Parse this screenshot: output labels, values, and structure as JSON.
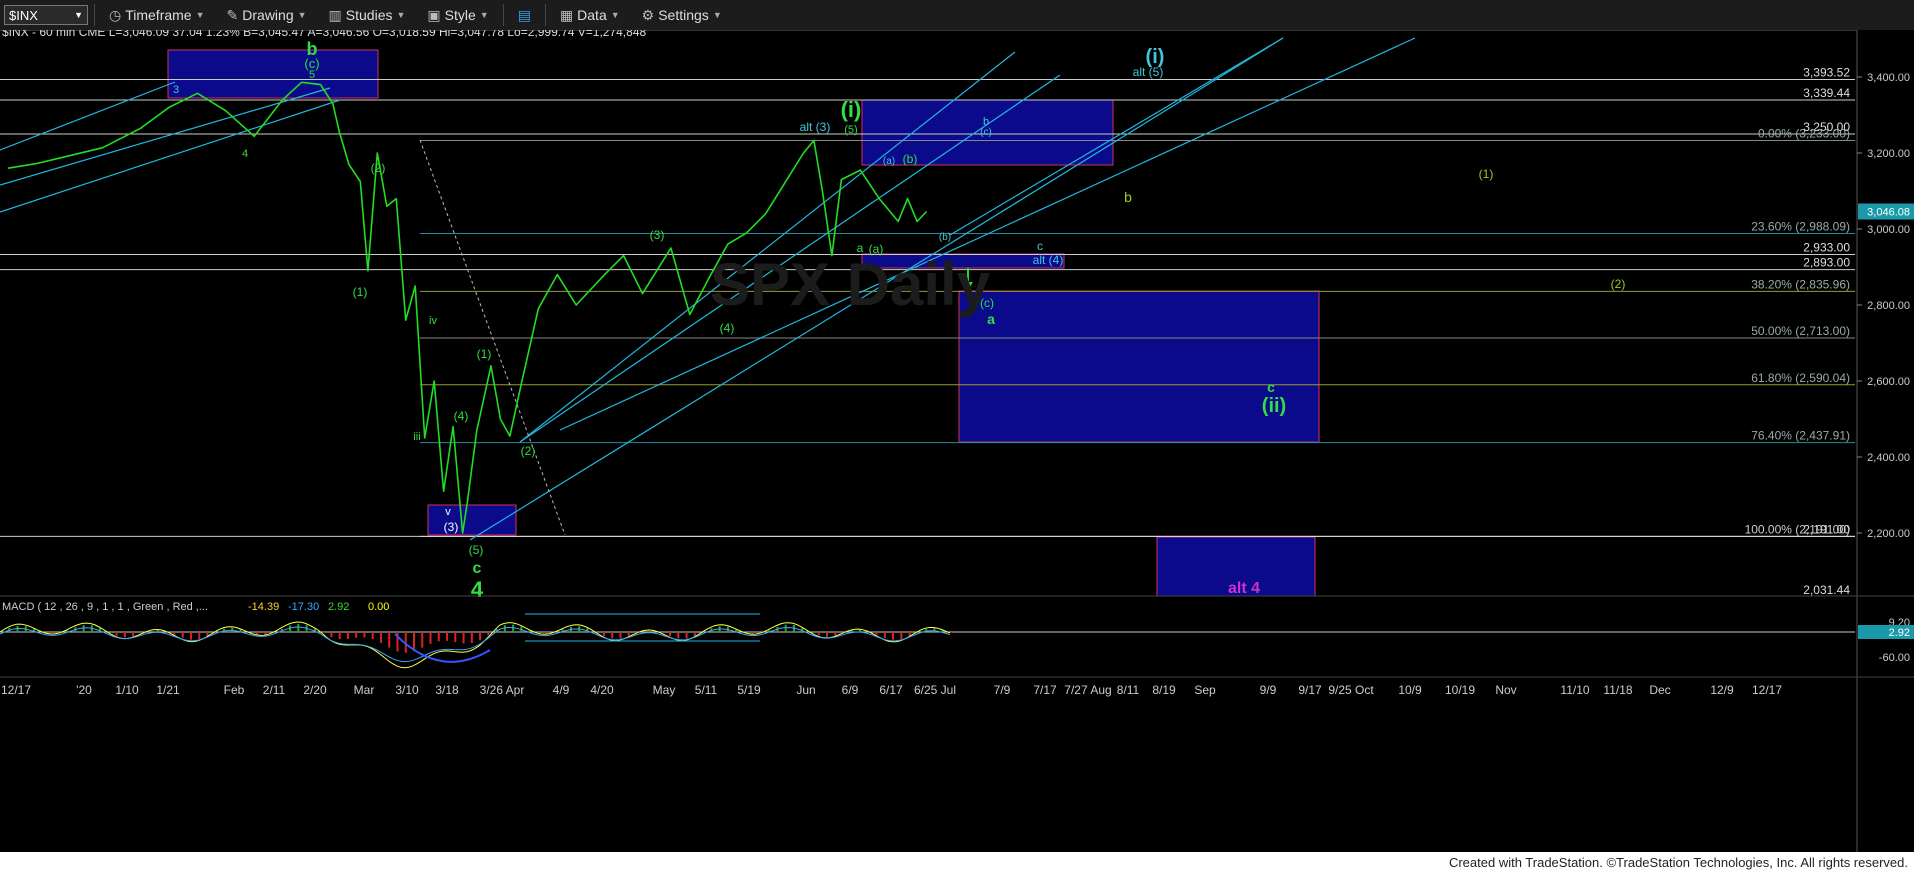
{
  "toolbar": {
    "symbol": "$INX",
    "timeframe": "Timeframe",
    "drawing": "Drawing",
    "studies": "Studies",
    "style": "Style",
    "data": "Data",
    "settings": "Settings"
  },
  "header_line": "$INX - 60 min  CME  L=3,046.09  37.04  1.23%  B=3,045.47  A=3,046.56  O=3,018.59  Hi=3,047.78  Lo=2,999.74  V=1,274,848",
  "footer": "Created with TradeStation. ©TradeStation Technologies, Inc. All rights reserved.",
  "colors": {
    "price": "#22dd22",
    "channel": "#20b8e0",
    "box_fill": "#0a0a8a",
    "box_border": "#d03060",
    "label_green": "#33dd44",
    "label_cyan": "#40c8d8",
    "alt4": "#cc33cc",
    "last_price_bg": "#1a9aa8"
  },
  "chart_data": {
    "type": "line",
    "title": "$INX - 60 min",
    "ylim": [
      2031.44,
      3480
    ],
    "yticks": [
      "3,400.00",
      "3,200.00",
      "3,000.00",
      "2,800.00",
      "2,600.00",
      "2,400.00",
      "2,200.00"
    ],
    "xticks": [
      "12/17",
      "'20",
      "1/10",
      "1/21",
      "Feb",
      "2/11",
      "2/20",
      "Mar",
      "3/10",
      "3/18",
      "3/26 Apr",
      "4/9",
      "4/20",
      "May",
      "5/11",
      "5/19",
      "Jun",
      "6/9",
      "6/17",
      "6/25 Jul",
      "7/9",
      "7/17",
      "7/27 Aug",
      "8/11",
      "8/19",
      "Sep",
      "9/9",
      "9/17",
      "9/25 Oct",
      "10/9",
      "10/19",
      "Nov",
      "11/10",
      "11/18",
      "Dec",
      "12/9",
      "12/17"
    ],
    "last_price": "3,046.08",
    "series": [
      {
        "values": [
          [
            0,
            3160
          ],
          [
            0.03,
            3172
          ],
          [
            0.06,
            3190
          ],
          [
            0.1,
            3214
          ],
          [
            0.14,
            3265
          ],
          [
            0.17,
            3320
          ],
          [
            0.2,
            3357
          ],
          [
            0.23,
            3311
          ],
          [
            0.26,
            3244
          ],
          [
            0.29,
            3340
          ],
          [
            0.31,
            3386
          ],
          [
            0.33,
            3380
          ],
          [
            0.343,
            3330
          ],
          [
            0.35,
            3255
          ],
          [
            0.36,
            3170
          ],
          [
            0.372,
            3125
          ],
          [
            0.38,
            2890
          ],
          [
            0.39,
            3200
          ],
          [
            0.4,
            3060
          ],
          [
            0.41,
            3080
          ],
          [
            0.42,
            2760
          ],
          [
            0.43,
            2850
          ],
          [
            0.44,
            2450
          ],
          [
            0.45,
            2600
          ],
          [
            0.46,
            2310
          ],
          [
            0.47,
            2480
          ],
          [
            0.48,
            2200
          ],
          [
            0.485,
            2280
          ],
          [
            0.495,
            2470
          ],
          [
            0.51,
            2640
          ],
          [
            0.52,
            2500
          ],
          [
            0.53,
            2455
          ],
          [
            0.54,
            2570
          ],
          [
            0.56,
            2790
          ],
          [
            0.58,
            2880
          ],
          [
            0.6,
            2800
          ],
          [
            0.63,
            2880
          ],
          [
            0.65,
            2930
          ],
          [
            0.67,
            2830
          ],
          [
            0.7,
            2950
          ],
          [
            0.72,
            2775
          ],
          [
            0.74,
            2870
          ],
          [
            0.76,
            2960
          ],
          [
            0.78,
            2990
          ],
          [
            0.8,
            3040
          ],
          [
            0.82,
            3120
          ],
          [
            0.84,
            3200
          ],
          [
            0.851,
            3233
          ],
          [
            0.86,
            3100
          ],
          [
            0.87,
            2930
          ],
          [
            0.88,
            3130
          ],
          [
            0.9,
            3155
          ],
          [
            0.92,
            3080
          ],
          [
            0.94,
            3020
          ],
          [
            0.95,
            3080
          ],
          [
            0.96,
            3020
          ],
          [
            0.97,
            3046
          ]
        ]
      }
    ],
    "levels": [
      {
        "value": "3,393.52",
        "price": 3393.52,
        "color": "#dddddd"
      },
      {
        "value": "3,339.44",
        "price": 3339.44,
        "color": "#dddddd"
      },
      {
        "value": "3,250.00",
        "price": 3250,
        "color": "#dddddd"
      },
      {
        "value": "2,933.00",
        "price": 2933,
        "color": "#dddddd"
      },
      {
        "value": "2,893.00",
        "price": 2893,
        "color": "#dddddd"
      },
      {
        "value": "2,191.00",
        "price": 2191,
        "color": "#dddddd"
      },
      {
        "value": "2,031.44",
        "price": 2031.44,
        "color": "#dddddd"
      }
    ],
    "fib": [
      {
        "label": "0.00% (3,233.00)",
        "price": 3233,
        "color": "#888888"
      },
      {
        "label": "23.60% (2,988.09)",
        "price": 2988.09,
        "color": "#1f8f9f"
      },
      {
        "label": "38.20% (2,835.96)",
        "price": 2835.96,
        "color": "#999933"
      },
      {
        "label": "50.00% (2,713.00)",
        "price": 2713,
        "color": "#888888"
      },
      {
        "label": "61.80% (2,590.04)",
        "price": 2590.04,
        "color": "#999933"
      },
      {
        "label": "76.40% (2,437.91)",
        "price": 2437.91,
        "color": "#1f8f9f"
      },
      {
        "label": "100.00% (2,191.00)",
        "price": 2191,
        "color": "#dddddd"
      }
    ],
    "wave_labels": [
      "b",
      "(c)",
      "5",
      "3",
      "4",
      "(2)",
      "(1)",
      "iv",
      "(1)",
      "(4)",
      "iii",
      "v",
      "(3)",
      "(5)",
      "c",
      "4",
      "(2)",
      "(3)",
      "(4)",
      "alt (3)",
      "(5)",
      "(i)",
      "(a)",
      "(b)",
      "a",
      "(a)",
      "(b)",
      "b",
      "(c)",
      "c",
      "alt (4)",
      "(c)",
      "a",
      "c",
      "(ii)",
      "(i)",
      "alt (5)",
      "b",
      "(1)",
      "(2)",
      "alt 4"
    ],
    "macd": {
      "label": "MACD ( 12 , 26 , 9 , 1 , 1 , Green , Red ,...",
      "values": [
        "-14.39",
        "-17.30",
        "2.92",
        "0.00"
      ],
      "yticks": [
        "9.20",
        "2.92",
        "-60.00"
      ]
    }
  }
}
